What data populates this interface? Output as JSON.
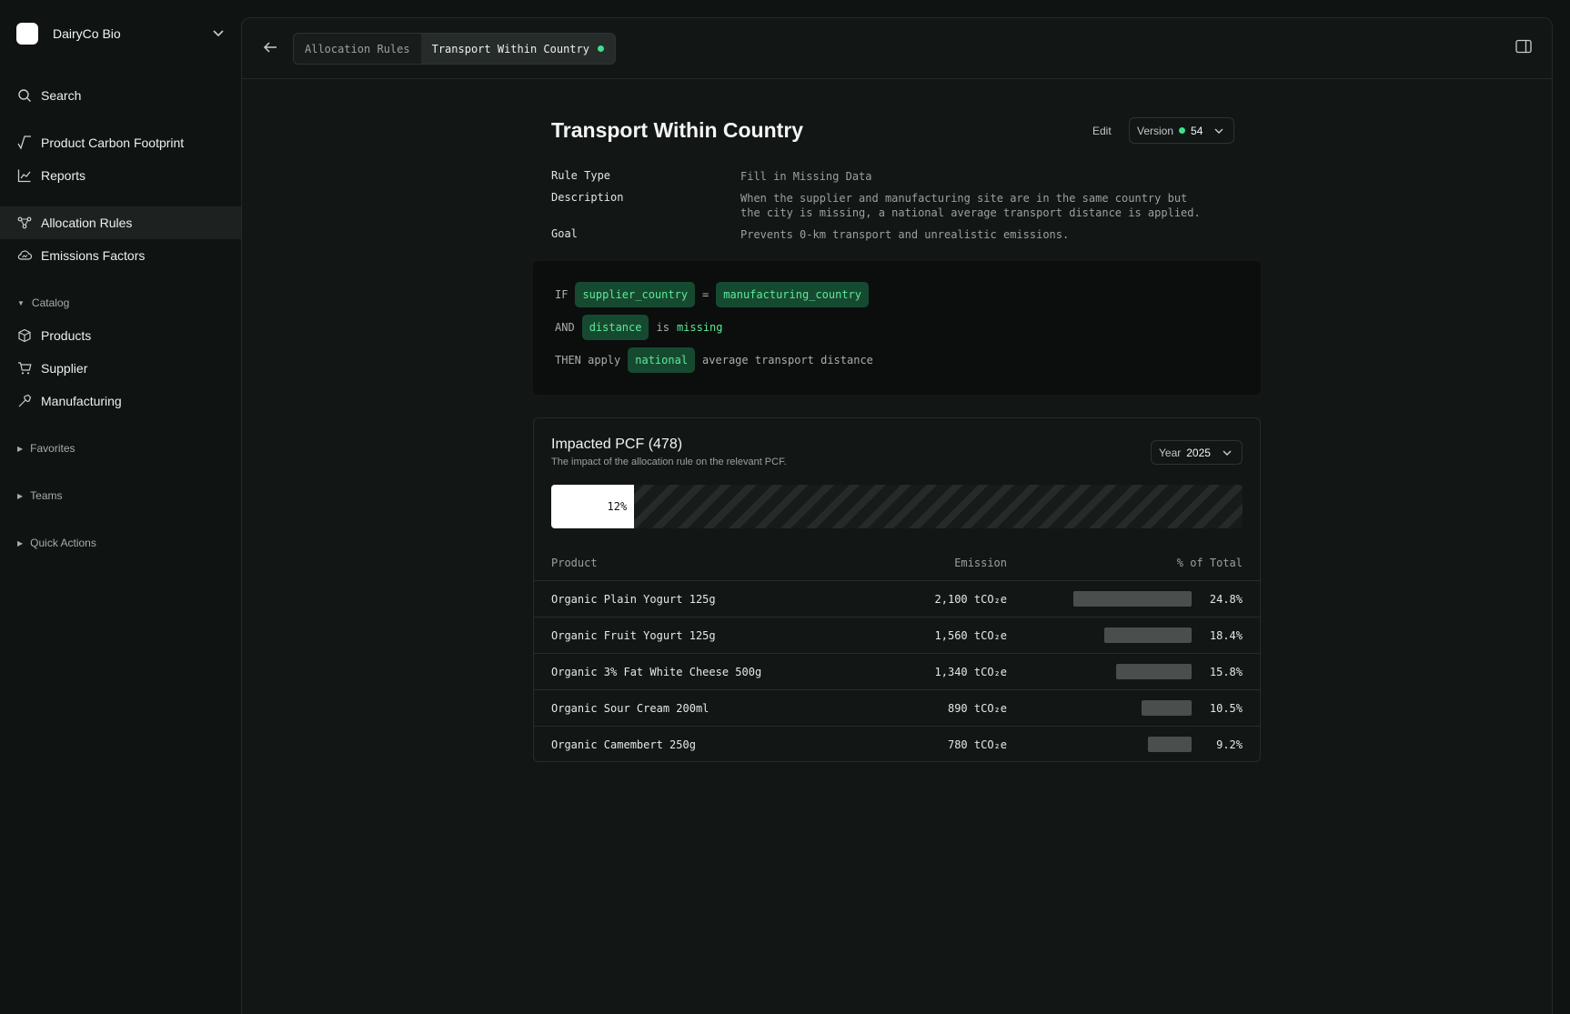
{
  "org": {
    "name": "DairyCo Bio"
  },
  "nav": {
    "search": "Search",
    "items": [
      "Product Carbon Footprint",
      "Reports",
      "Allocation Rules",
      "Emissions Factors"
    ],
    "catalog": {
      "label": "Catalog",
      "items": [
        "Products",
        "Supplier",
        "Manufacturing"
      ]
    },
    "favorites": "Favorites",
    "teams": "Teams",
    "quick_actions": "Quick Actions"
  },
  "breadcrumb": {
    "parent": "Allocation Rules",
    "current": "Transport Within Country"
  },
  "rule": {
    "title": "Transport Within Country",
    "edit": "Edit",
    "version_label": "Version",
    "version_number": "54",
    "meta": [
      {
        "label": "Rule Type",
        "value": "Fill in Missing Data"
      },
      {
        "label": "Description",
        "value": "When the supplier and manufacturing site are in the same country but the city is missing, a national average transport distance is applied."
      },
      {
        "label": "Goal",
        "value": "Prevents 0-km transport and unrealistic emissions."
      }
    ],
    "logic": {
      "if_kw": "IF",
      "if_left": "supplier_country",
      "if_op": "=",
      "if_right": "manufacturing_country",
      "and_kw": "AND",
      "and_field": "distance",
      "and_is": "is",
      "and_value": "missing",
      "then_kw": "THEN apply",
      "then_value": "national",
      "then_rest": "average transport distance"
    }
  },
  "impact": {
    "title": "Impacted PCF (478)",
    "subtitle": "The impact of the allocation rule on the relevant PCF.",
    "year_label": "Year",
    "year_value": "2025",
    "share": 0.12,
    "share_label": "12%",
    "columns": {
      "product": "Product",
      "emission": "Emission",
      "pct": "% of Total"
    },
    "rows": [
      {
        "product": "Organic Plain Yogurt 125g",
        "emission": "2,100 tCO₂e",
        "pct": "24.8%",
        "share": 24.8
      },
      {
        "product": "Organic Fruit Yogurt 125g",
        "emission": "1,560 tCO₂e",
        "pct": "18.4%",
        "share": 18.4
      },
      {
        "product": "Organic 3% Fat White Cheese 500g",
        "emission": "1,340 tCO₂e",
        "pct": "15.8%",
        "share": 15.8
      },
      {
        "product": "Organic Sour Cream 200ml",
        "emission": "890 tCO₂e",
        "pct": "10.5%",
        "share": 10.5
      },
      {
        "product": "Organic Camembert 250g",
        "emission": "780 tCO₂e",
        "pct": "9.2%",
        "share": 9.2
      }
    ]
  },
  "colors": {
    "accent": "#3fe08a",
    "chip_bg": "#164a30",
    "chip_text": "#5ee89a"
  }
}
